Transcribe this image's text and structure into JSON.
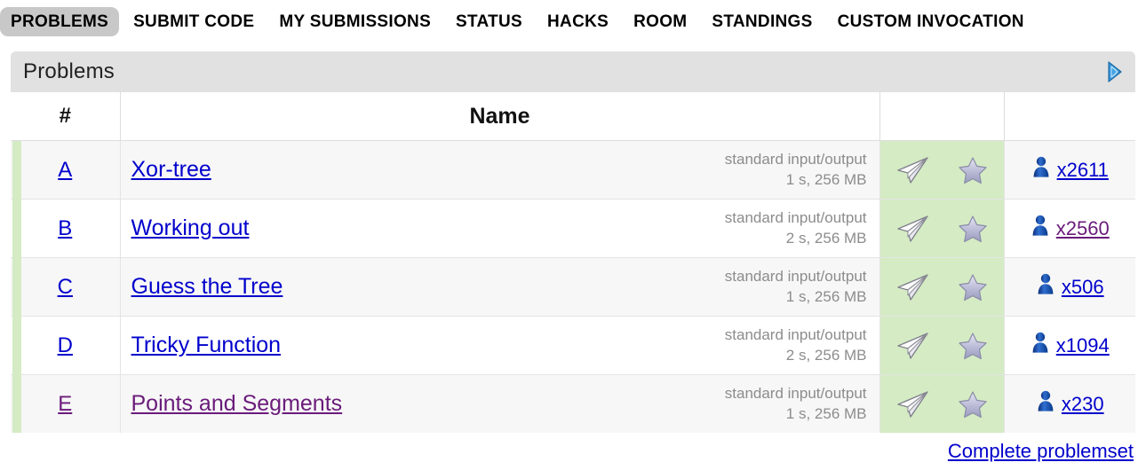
{
  "nav": {
    "items": [
      {
        "label": "PROBLEMS",
        "active": true
      },
      {
        "label": "SUBMIT CODE",
        "active": false
      },
      {
        "label": "MY SUBMISSIONS",
        "active": false
      },
      {
        "label": "STATUS",
        "active": false
      },
      {
        "label": "HACKS",
        "active": false
      },
      {
        "label": "ROOM",
        "active": false
      },
      {
        "label": "STANDINGS",
        "active": false
      },
      {
        "label": "CUSTOM INVOCATION",
        "active": false
      }
    ]
  },
  "panel": {
    "title": "Problems",
    "expand_icon": "triangle-right-icon"
  },
  "table": {
    "headers": {
      "index": "#",
      "name": "Name",
      "actions": "",
      "solved": ""
    },
    "rows": [
      {
        "index": "A",
        "name": "Xor-tree",
        "io": "standard input/output",
        "limits": "1 s, 256 MB",
        "submit_icon": "paper-plane-icon",
        "favorite_icon": "star-icon",
        "solver_icon": "user-icon",
        "solved_count": "x2611",
        "name_visited": false,
        "index_visited": false,
        "solved_visited": false
      },
      {
        "index": "B",
        "name": "Working out",
        "io": "standard input/output",
        "limits": "2 s, 256 MB",
        "submit_icon": "paper-plane-icon",
        "favorite_icon": "star-icon",
        "solver_icon": "user-icon",
        "solved_count": "x2560",
        "name_visited": false,
        "index_visited": false,
        "solved_visited": true
      },
      {
        "index": "C",
        "name": "Guess the Tree",
        "io": "standard input/output",
        "limits": "1 s, 256 MB",
        "submit_icon": "paper-plane-icon",
        "favorite_icon": "star-icon",
        "solver_icon": "user-icon",
        "solved_count": "x506",
        "name_visited": false,
        "index_visited": false,
        "solved_visited": false
      },
      {
        "index": "D",
        "name": "Tricky Function",
        "io": "standard input/output",
        "limits": "2 s, 256 MB",
        "submit_icon": "paper-plane-icon",
        "favorite_icon": "star-icon",
        "solver_icon": "user-icon",
        "solved_count": "x1094",
        "name_visited": false,
        "index_visited": false,
        "solved_visited": false
      },
      {
        "index": "E",
        "name": "Points and Segments",
        "io": "standard input/output",
        "limits": "1 s, 256 MB",
        "submit_icon": "paper-plane-icon",
        "favorite_icon": "star-icon",
        "solver_icon": "user-icon",
        "solved_count": "x230",
        "name_visited": true,
        "index_visited": true,
        "solved_visited": false
      }
    ]
  },
  "footer": {
    "complete_problemset": "Complete problemset"
  },
  "colors": {
    "link": "#0000cc",
    "link_visited": "#6a1b7a",
    "panel_header_bg": "#e1e1e1",
    "action_column_bg": "#d4ebc4",
    "row_alt_bg": "#f7f7f7",
    "muted_text": "#8c8c8c",
    "nav_active_bg": "#c8c8c8"
  }
}
